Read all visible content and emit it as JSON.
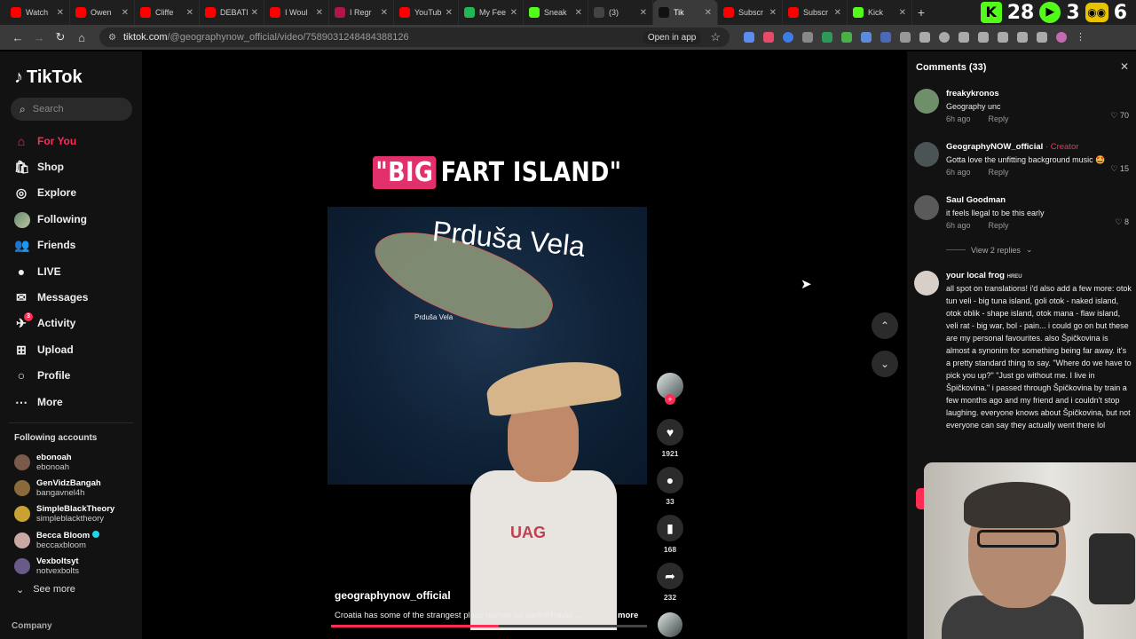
{
  "browser": {
    "tabs": [
      {
        "label": "Watch",
        "color": "#ff0000"
      },
      {
        "label": "Owen",
        "color": "#ff0000"
      },
      {
        "label": "Cliffe",
        "color": "#ff0000"
      },
      {
        "label": "DEBATI",
        "color": "#ff0000"
      },
      {
        "label": "I Woul",
        "color": "#ff0000"
      },
      {
        "label": "I Regr",
        "color": "#b0164a"
      },
      {
        "label": "YouTub",
        "color": "#ff0000"
      },
      {
        "label": "My Fee",
        "color": "#1db954"
      },
      {
        "label": "Sneak",
        "color": "#53fc18"
      },
      {
        "label": "(3)",
        "color": "#444444"
      },
      {
        "label": "Tik",
        "color": "#111111",
        "active": true
      },
      {
        "label": "Subscr",
        "color": "#ff0000"
      },
      {
        "label": "Subscr",
        "color": "#ff0000"
      },
      {
        "label": "Kick",
        "color": "#53fc18"
      }
    ],
    "overlay": {
      "num1": "28",
      "num2": "3",
      "num3": "6"
    },
    "url_host": "tiktok.com",
    "url_path": "/@geographynow_official/video/7589031248484388126",
    "open_in_app": "Open in app"
  },
  "sidebar": {
    "brand": "TikTok",
    "search_placeholder": "Search",
    "nav": [
      {
        "label": "For You",
        "icon": "home-icon",
        "active": true
      },
      {
        "label": "Shop",
        "icon": "shop-icon"
      },
      {
        "label": "Explore",
        "icon": "compass-icon"
      },
      {
        "label": "Following",
        "icon": "following-avatar"
      },
      {
        "label": "Friends",
        "icon": "friends-icon"
      },
      {
        "label": "LIVE",
        "icon": "live-icon"
      },
      {
        "label": "Messages",
        "icon": "messages-icon"
      },
      {
        "label": "Activity",
        "icon": "activity-icon",
        "badge": "3"
      },
      {
        "label": "Upload",
        "icon": "upload-icon"
      },
      {
        "label": "Profile",
        "icon": "profile-icon"
      },
      {
        "label": "More",
        "icon": "more-icon"
      }
    ],
    "following_title": "Following accounts",
    "following": [
      {
        "name": "ebonoah",
        "handle": "ebonoah",
        "color": "#7a5a4a"
      },
      {
        "name": "GenVidzBangah",
        "handle": "bangavnel4h",
        "color": "#8a6a3a"
      },
      {
        "name": "SimpleBlackTheory",
        "handle": "simpleblacktheory",
        "color": "#c9a233"
      },
      {
        "name": "Becca Bloom",
        "handle": "beccaxbloom",
        "color": "#c9a7a2",
        "verified": true
      },
      {
        "name": "Vexboltsyt",
        "handle": "notvexbolts",
        "color": "#6a5a8a"
      }
    ],
    "see_more": "See more",
    "company": "Company"
  },
  "video": {
    "title_highlight": "\"BIG",
    "title_rest": "FART ISLAND\"",
    "map_overlay_text": "Prduša Vela",
    "island_label": "Prduša Vela",
    "shirt_print": "UAG",
    "username": "geographynow_official",
    "description": "Croatia has some of the strangest place names on earth#Travel ...",
    "more": "more",
    "progress": 0.53,
    "likes": "1921",
    "comments": "33",
    "saves": "168",
    "shares": "232"
  },
  "comments": {
    "header": "Comments (33)",
    "items": [
      {
        "user": "freakykronos",
        "text": "Geography unc",
        "time": "6h ago",
        "reply": "Reply",
        "likes": "70",
        "color": "#6f8f6a"
      },
      {
        "user": "GeographyNOW_official",
        "creator": "· Creator",
        "text": "Gotta love the unfitting background music 🤩",
        "time": "6h ago",
        "reply": "Reply",
        "likes": "15",
        "color": "#4a5454"
      },
      {
        "user": "Saul Goodman",
        "text": "it feels llegal to be this early",
        "time": "6h ago",
        "reply": "Reply",
        "likes": "8",
        "color": "#5a5a5a"
      },
      {
        "user": "your local frog",
        "badge": "HREU",
        "text": "all spot on translations! i'd also add a few more: otok tun veli - big tuna island, goli otok - naked island, otok oblik - shape island, otok mana - flaw island, veli rat - big war, bol - pain... i could go on but these are my personal favourites. also Špičkovina is almost a synonim for something being far away. it's a pretty standard thing to say. \"Where do we have to pick you up?\" \"Just go without me. I live in Špičkovina.\" i passed through Špičkovina by train a few months ago and my friend and i couldn't stop laughing. everyone knows about Špičkovina, but not everyone can say they actually went there lol",
        "color": "#d8cfc8"
      }
    ],
    "view_replies": "View 2 replies"
  }
}
